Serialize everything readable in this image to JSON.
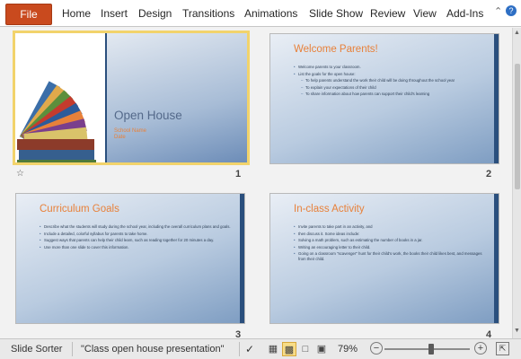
{
  "ribbon": {
    "file_label": "File",
    "tabs": [
      "Home",
      "Insert",
      "Design",
      "Transitions",
      "Animations",
      "Slide Show",
      "Review",
      "View",
      "Add-Ins"
    ],
    "minimize_icon": "chevron-up-icon",
    "help_icon": "help-icon",
    "accent_color": "#c94a1e"
  },
  "slides": [
    {
      "number": "1",
      "title": "Open House",
      "subtitle_lines": [
        "School Name",
        "Date"
      ]
    },
    {
      "number": "2",
      "title": "Welcome Parents!",
      "bullets": [
        {
          "text": "Welcome parents to your classroom.",
          "level": 1
        },
        {
          "text": "List the goals for the open house:",
          "level": 1
        },
        {
          "text": "To help parents understand the work their child will be doing throughout the school year",
          "level": 2
        },
        {
          "text": "To explain your expectations of their child",
          "level": 2
        },
        {
          "text": "To share information about how parents can support their child's learning",
          "level": 2
        }
      ]
    },
    {
      "number": "3",
      "title": "Curriculum Goals",
      "bullets": [
        {
          "text": "Describe what the students will study during the school year, including the overall curriculum plans and goals.",
          "level": 1
        },
        {
          "text": "Include a detailed, colorful syllabus for parents to take home.",
          "level": 1
        },
        {
          "text": "Suggest ways that parents can help their child learn, such as reading together for 20 minutes a day.",
          "level": 1
        },
        {
          "text": "Use more than one slide to cover this information.",
          "level": 1
        }
      ]
    },
    {
      "number": "4",
      "title": "In-class Activity",
      "bullets": [
        {
          "text": "Invite parents to take part in an activity, and",
          "level": 1
        },
        {
          "text": "then discuss it. Some ideas include:",
          "level": 1
        },
        {
          "text": "Solving a math problem, such as estimating the number of books in a jar.",
          "level": 1
        },
        {
          "text": "Writing an encouraging letter to their child.",
          "level": 1
        },
        {
          "text": "Going on a classroom \"scavenger\" hunt for their child's work, the books their child likes best, and messages from their child.",
          "level": 1
        }
      ]
    }
  ],
  "status_bar": {
    "view_name": "Slide Sorter",
    "file_title": "\"Class open house presentation\"",
    "zoom_level": "79%",
    "zoom_fraction": 0.55
  },
  "colors": {
    "slide_title": "#e8813a",
    "selection": "#f2d36b",
    "slide_accent": "#2a4f7d"
  }
}
